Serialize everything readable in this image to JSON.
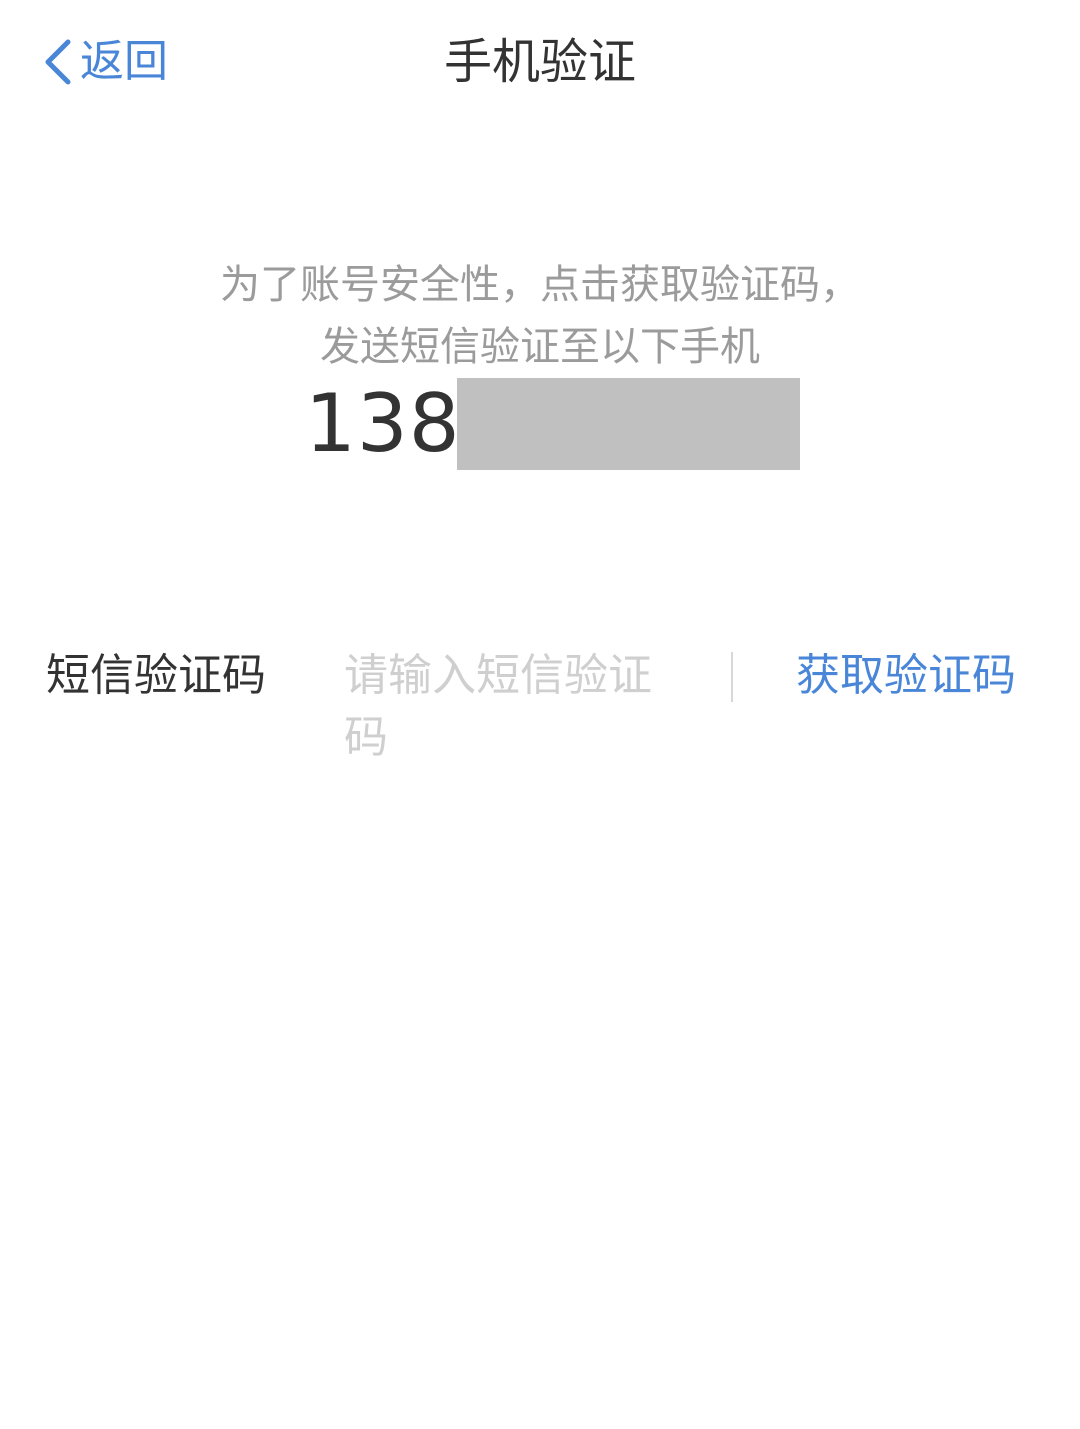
{
  "nav": {
    "back_label": "返回",
    "title": "手机验证",
    "back_icon": "chevron-left-icon"
  },
  "intro": {
    "line1": "为了账号安全性，点击获取验证码，",
    "line2": "发送短信验证至以下手机"
  },
  "phone": {
    "prefix": "138"
  },
  "form": {
    "code_label": "短信验证码",
    "code_placeholder": "请输入短信验证码",
    "code_value": "",
    "get_code_label": "获取验证码"
  },
  "colors": {
    "accent": "#4a86d8",
    "text_primary": "#333333",
    "text_secondary": "#9b9b9b",
    "placeholder": "#cfcfcf",
    "mask": "#c0c0c0",
    "background": "#ffffff"
  }
}
